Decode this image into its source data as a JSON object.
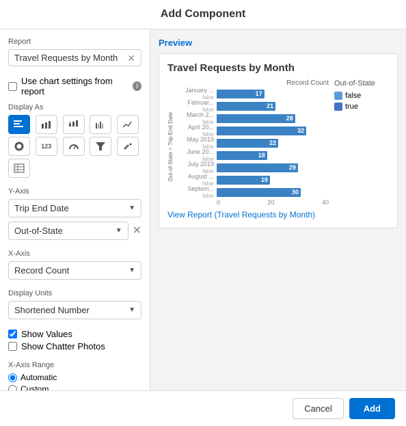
{
  "title": "Add Component",
  "left": {
    "report_label": "Report",
    "report_value": "Travel Requests by Month",
    "use_chart_label": "Use chart settings from report",
    "display_as_label": "Display As",
    "display_buttons": [
      {
        "icon": "≡",
        "label": "horizontal-bar",
        "active": true
      },
      {
        "icon": "▐",
        "label": "vertical-bar",
        "active": false
      },
      {
        "icon": "⊞",
        "label": "stacked-bar",
        "active": false
      },
      {
        "icon": "∥",
        "label": "grouped-bar",
        "active": false
      },
      {
        "icon": "∿",
        "label": "line",
        "active": false
      },
      {
        "icon": "◔",
        "label": "donut",
        "active": false
      },
      {
        "icon": "123",
        "label": "number",
        "active": false
      },
      {
        "icon": "⚡",
        "label": "gauge",
        "active": false
      },
      {
        "icon": "≣",
        "label": "funnel",
        "active": false
      },
      {
        "icon": "⊡",
        "label": "scatter",
        "active": false
      },
      {
        "icon": "▦",
        "label": "table",
        "active": false
      }
    ],
    "y_axis_label": "Y-Axis",
    "y_axis_1": "Trip End Date",
    "y_axis_2": "Out-of-State",
    "x_axis_label": "X-Axis",
    "x_axis_1": "Record Count",
    "display_units_label": "Display Units",
    "display_units_value": "Shortened Number",
    "show_values_label": "Show Values",
    "show_chatter_label": "Show Chatter Photos",
    "x_axis_range_label": "X-Axis Range",
    "radio_auto": "Automatic",
    "radio_custom": "Custom"
  },
  "right": {
    "preview_label": "Preview",
    "chart_title": "Travel Requests by Month",
    "x_axis_header": "Record Count",
    "x_ticks": [
      "0",
      "20",
      "40"
    ],
    "legend_title": "Out-of-State",
    "legend_items": [
      {
        "label": "false",
        "color": "#5b9bd5"
      },
      {
        "label": "true",
        "color": "#4472c4"
      }
    ],
    "y_axis_group": "Out-of-State > Trip End Date",
    "bars": [
      {
        "label": "January ...",
        "sublabel": "false",
        "value": 17,
        "max": 40
      },
      {
        "label": "Februar...",
        "sublabel": "false",
        "value": 21,
        "max": 40
      },
      {
        "label": "March 2...",
        "sublabel": "false",
        "value": 28,
        "max": 40
      },
      {
        "label": "April 20...",
        "sublabel": "false",
        "value": 32,
        "max": 40
      },
      {
        "label": "May 2019",
        "sublabel": "false",
        "value": 22,
        "max": 40
      },
      {
        "label": "June 20...",
        "sublabel": "false",
        "value": 18,
        "max": 40
      },
      {
        "label": "July 2019",
        "sublabel": "false",
        "value": 29,
        "max": 40
      },
      {
        "label": "August ...",
        "sublabel": "false",
        "value": 19,
        "max": 40
      },
      {
        "label": "Septem...",
        "sublabel": "false",
        "value": 30,
        "max": 40
      }
    ],
    "view_report_link": "View Report (Travel Requests by Month)"
  },
  "footer": {
    "cancel_label": "Cancel",
    "add_label": "Add"
  }
}
